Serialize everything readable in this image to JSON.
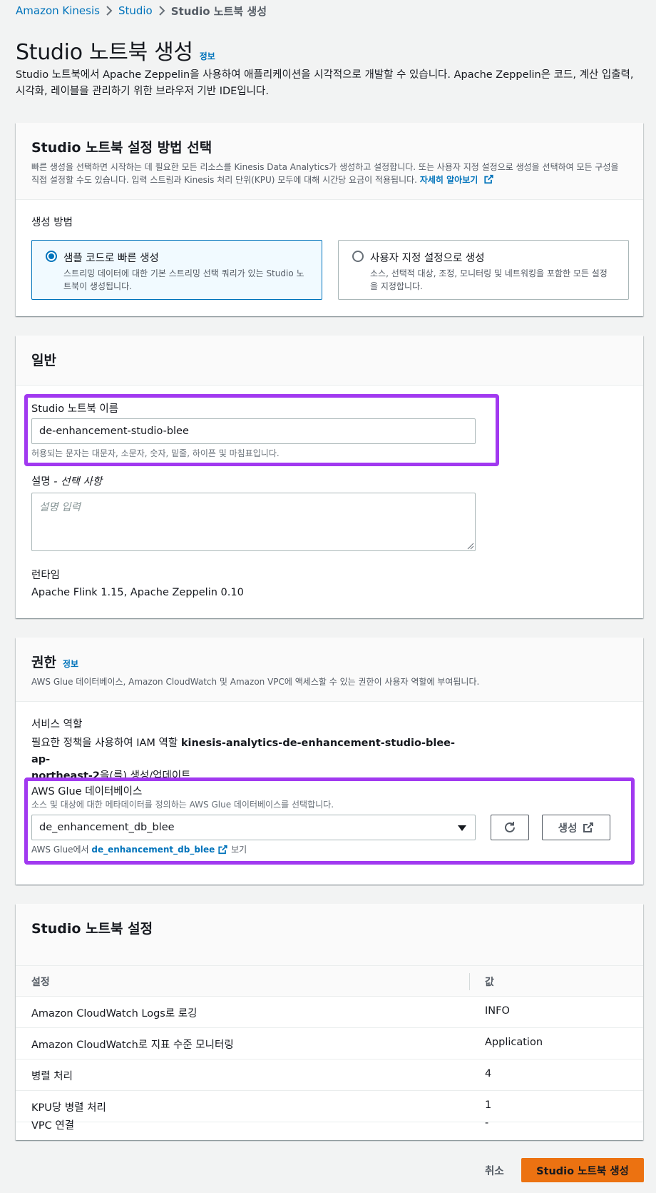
{
  "breadcrumb": {
    "items": [
      "Amazon Kinesis",
      "Studio"
    ],
    "current": "Studio 노트북 생성"
  },
  "header": {
    "title": "Studio 노트북 생성",
    "info": "정보",
    "description": "Studio 노트북에서 Apache Zeppelin을 사용하여 애플리케이션을 시각적으로 개발할 수 있습니다. Apache Zeppelin은 코드, 계산 입출력, 시각화, 레이블을 관리하기 위한 브라우저 기반 IDE입니다."
  },
  "setup_panel": {
    "title": "Studio 노트북 설정 방법 선택",
    "description": "빠른 생성을 선택하면 시작하는 데 필요한 모든 리소스를 Kinesis Data Analytics가 생성하고 설정합니다. 또는 사용자 지정 설정으로 생성을 선택하여 모든 구성을 직접 설정할 수도 있습니다. 입력 스트림과 Kinesis 처리 단위(KPU) 모두에 대해 시간당 요금이 적용됩니다.",
    "learn_more": "자세히 알아보기",
    "method_label": "생성 방법",
    "options": [
      {
        "title": "샘플 코드로 빠른 생성",
        "description": "스트리밍 데이터에 대한 기본 스트리밍 선택 쿼리가 있는 Studio 노트북이 생성됩니다.",
        "selected": true
      },
      {
        "title": "사용자 지정 설정으로 생성",
        "description": "소스, 선택적 대상, 조정, 모니터링 및 네트워킹을 포함한 모든 설정을 지정합니다.",
        "selected": false
      }
    ]
  },
  "general_panel": {
    "title": "일반",
    "name_label": "Studio 노트북 이름",
    "name_value": "de-enhancement-studio-blee",
    "name_hint": "허용되는 문자는 대문자, 소문자, 숫자, 밑줄, 하이픈 및 마침표입니다.",
    "desc_label": "설명",
    "desc_optional": "- 선택 사항",
    "desc_placeholder": "설명 입력",
    "runtime_label": "런타임",
    "runtime_value": "Apache Flink 1.15, Apache Zeppelin 0.10"
  },
  "permissions_panel": {
    "title": "권한",
    "info": "정보",
    "description": "AWS Glue 데이터베이스, Amazon CloudWatch 및 Amazon VPC에 액세스할 수 있는 권한이 사용자 역할에 부여됩니다.",
    "service_role_label": "서비스 역할",
    "service_role_prefix": "필요한 정책을 사용하여 IAM 역할 ",
    "service_role_name_1": "kinesis-analytics-de-enhancement-studio-blee-ap-",
    "service_role_name_2": "northeast-2",
    "service_role_suffix": "을(를) 생성/업데이트",
    "glue_label": "AWS Glue 데이터베이스",
    "glue_hint": "소스 및 대상에 대한 메타데이터를 정의하는 AWS Glue 데이터베이스를 선택합니다.",
    "glue_selected": "de_enhancement_db_blee",
    "create_button": "생성",
    "view_prefix": "AWS Glue에서 ",
    "view_link": "de_enhancement_db_blee",
    "view_suffix": " 보기"
  },
  "settings_panel": {
    "title": "Studio 노트북 설정",
    "columns": [
      "설정",
      "값"
    ],
    "rows": [
      {
        "setting": "Amazon CloudWatch Logs로 로깅",
        "value": "INFO"
      },
      {
        "setting": "Amazon CloudWatch로 지표 수준 모니터링",
        "value": "Application"
      },
      {
        "setting": "병렬 처리",
        "value": "4"
      },
      {
        "setting": "KPU당 병렬 처리",
        "value": "1"
      },
      {
        "setting": "VPC 연결",
        "value": "-"
      }
    ]
  },
  "footer": {
    "cancel": "취소",
    "submit": "Studio 노트북 생성"
  },
  "colors": {
    "link": "#0073bb",
    "primary_button": "#ec7211",
    "highlight": "#a139f0"
  }
}
